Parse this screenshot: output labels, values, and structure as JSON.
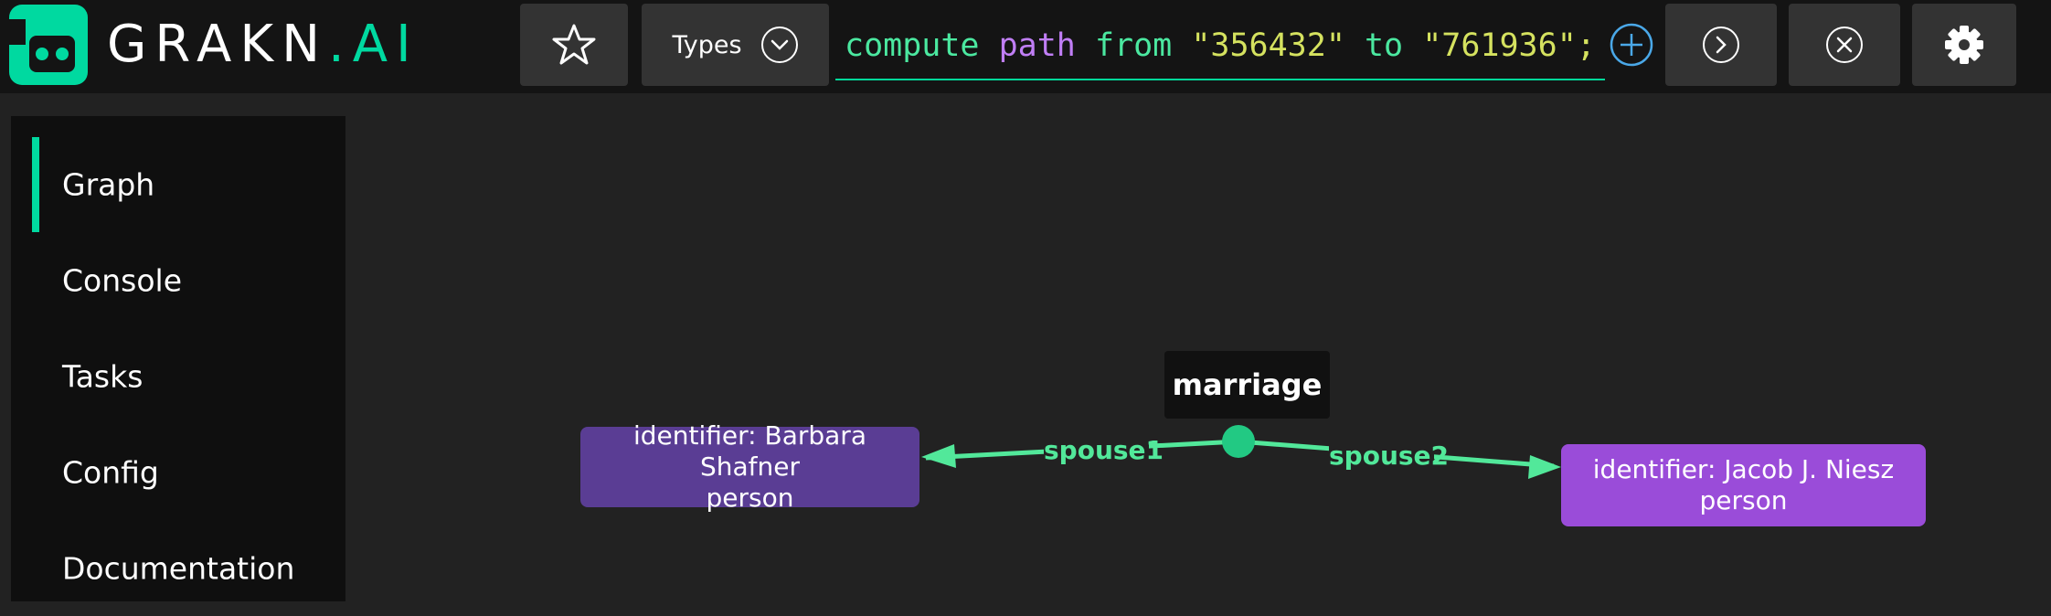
{
  "app": {
    "logo_text": "GRAKN",
    "logo_suffix": ".AI"
  },
  "toolbar": {
    "favourites_icon": "star-icon",
    "types_label": "Types",
    "types_icon": "chevron-down-circle-icon",
    "query": {
      "parts": [
        {
          "text": "compute ",
          "kind": "keyword"
        },
        {
          "text": "path",
          "kind": "type"
        },
        {
          "text": " from ",
          "kind": "keyword"
        },
        {
          "text": "\"356432\"",
          "kind": "string"
        },
        {
          "text": " to ",
          "kind": "keyword"
        },
        {
          "text": "\"761936\"",
          "kind": "string"
        },
        {
          "text": ";",
          "kind": "string"
        }
      ]
    },
    "add_icon": "plus-circle-icon",
    "run_icon": "chevron-right-circle-icon",
    "clear_icon": "close-circle-icon",
    "settings_icon": "gear-icon"
  },
  "sidebar": {
    "items": [
      {
        "label": "Graph",
        "active": true
      },
      {
        "label": "Console",
        "active": false
      },
      {
        "label": "Tasks",
        "active": false
      },
      {
        "label": "Config",
        "active": false
      },
      {
        "label": "Documentation",
        "active": false
      }
    ]
  },
  "graph": {
    "relation": {
      "label": "marriage"
    },
    "nodes": [
      {
        "line1": "identifier: Barbara Shafner",
        "line2": "person"
      },
      {
        "line1": "identifier: Jacob J. Niesz",
        "line2": "person"
      }
    ],
    "edges": [
      {
        "label": "spouse1"
      },
      {
        "label": "spouse2"
      }
    ]
  },
  "colors": {
    "accent": "#00d9a0",
    "edge": "#52e89a",
    "node_1": "#5a3d94",
    "node_2": "#9a4cd9",
    "topbar_bg": "#141414",
    "canvas_bg": "#222222"
  }
}
